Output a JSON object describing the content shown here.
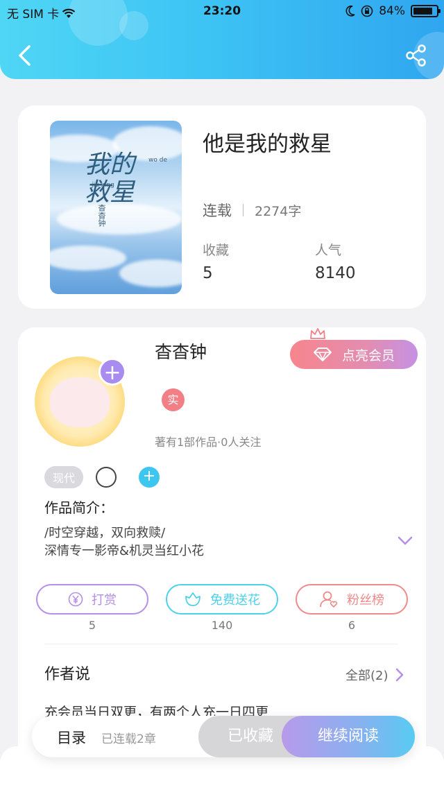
{
  "status_bar": {
    "carrier": "无 SIM 卡",
    "time": "23:20",
    "battery": "84%",
    "battery_level": 0.84
  },
  "nav": {
    "back_icon": "chevron-left-icon",
    "share_icon": "share-icon"
  },
  "book": {
    "title": "他是我的救星",
    "cover_title": "我的\n救星",
    "cover_pinyin": "wo de",
    "cover_pinyin2": "jiu xing",
    "cover_author": "杳杳钟",
    "status": "连载",
    "word_count": "2274字",
    "favorites_label": "收藏",
    "favorites_value": "5",
    "popularity_label": "人气",
    "popularity_value": "8140"
  },
  "author": {
    "name": "杳杳钟",
    "real_badge": "实",
    "stats": "著有1部作品·0人关注",
    "follow_symbol": "+",
    "vip_label": "点亮会员",
    "tag": "现代",
    "tag_add_symbol": "+",
    "intro_title": "作品简介：",
    "intro_line1": "/时空穿越，双向救赎/",
    "intro_line2": "深情专一影帝&机灵当红小花"
  },
  "actions": [
    {
      "label": "打赏",
      "count": "5",
      "icon": "yen-coin-icon",
      "color": "#b58ee6"
    },
    {
      "label": "免费送花",
      "count": "140",
      "icon": "flower-icon",
      "color": "#4fd0ea"
    },
    {
      "label": "粉丝榜",
      "count": "6",
      "icon": "fan-user-icon",
      "color": "#ee8a8a"
    }
  ],
  "author_says": {
    "title": "作者说",
    "all_label": "全部(2)",
    "text": "充会员当日双更，有两个人充一日四更"
  },
  "bottom_bar": {
    "toc_label": "目录",
    "toc_status": "已连载2章",
    "collected_label": "已收藏",
    "continue_label": "继续阅读"
  }
}
